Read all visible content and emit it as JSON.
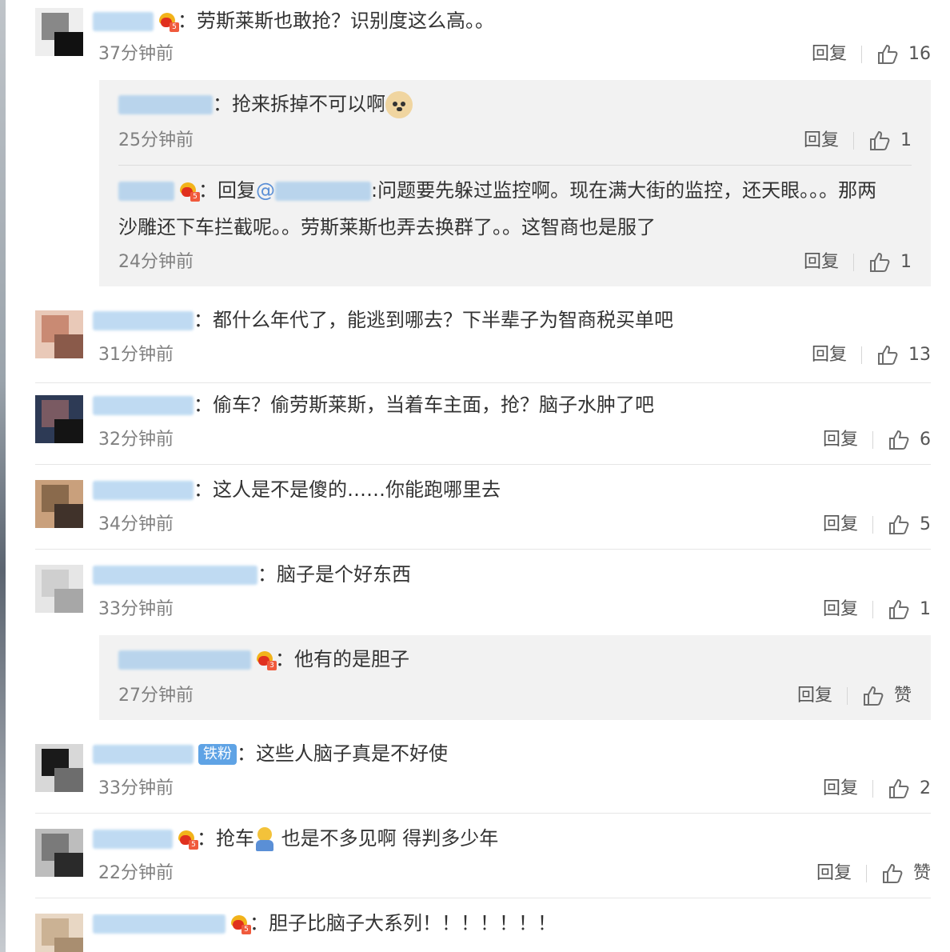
{
  "ui": {
    "reply_label": "回复"
  },
  "comments": [
    {
      "text": "劳斯莱斯也敢抢？识别度这么高。。",
      "time": "37分钟前",
      "likes": "16"
    },
    {
      "text": "都什么年代了，能逃到哪去？下半辈子为智商税买单吧",
      "time": "31分钟前",
      "likes": "13"
    },
    {
      "text": "偷车？偷劳斯莱斯，当着车主面，抢？脑子水肿了吧",
      "time": "32分钟前",
      "likes": "6"
    },
    {
      "text": "这人是不是傻的……你能跑哪里去",
      "time": "34分钟前",
      "likes": "5"
    },
    {
      "text": "脑子是个好东西",
      "time": "33分钟前",
      "likes": "1"
    },
    {
      "badge": "铁粉",
      "text": "这些人脑子真是不好使",
      "time": "33分钟前",
      "likes": "2"
    },
    {
      "text_before": "抢车",
      "text_after": " 也是不多见啊  得判多少年",
      "time": "22分钟前",
      "likes": "赞"
    },
    {
      "text": "胆子比脑子大系列！！！！！！！"
    }
  ],
  "replies": [
    {
      "text": "抢来拆掉不可以啊",
      "time": "25分钟前",
      "likes": "1"
    },
    {
      "prefix": "回复",
      "mention": "@",
      "text": ":问题要先躲过监控啊。现在满大街的监控，还天眼。。。那两",
      "text2": "沙雕还下车拦截呢。。劳斯莱斯也弄去换群了。。这智商也是服了",
      "time": "24分钟前",
      "likes": "1"
    },
    {
      "text": "他有的是胆子",
      "time": "27分钟前",
      "likes": "赞"
    }
  ],
  "icons": {
    "like": "thumbs-up-icon",
    "vip": "vip-crown-icon",
    "emoji_dog": "doge-emoji-icon",
    "emoji_man": "emoji-man-icon"
  }
}
